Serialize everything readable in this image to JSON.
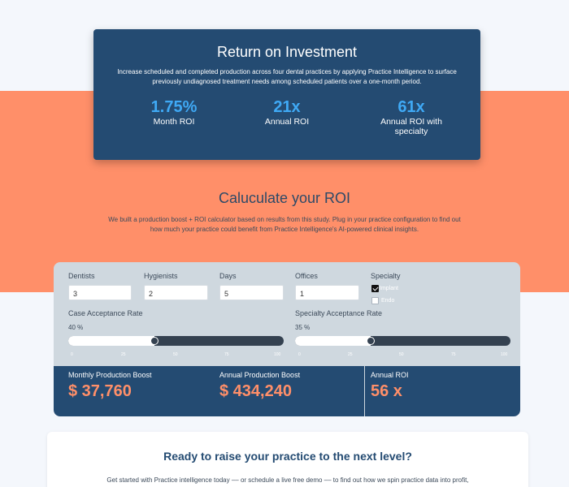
{
  "roi": {
    "title": "Return on Investment",
    "description": "Increase scheduled and completed production across four dental practices by applying Practice Intelligence to surface previously undiagnosed treatment needs among scheduled patients over a one-month period.",
    "stats": [
      {
        "value": "1.75%",
        "label": "Month ROI"
      },
      {
        "value": "21x",
        "label": "Annual ROI"
      },
      {
        "value": "61x",
        "label": "Annual ROI with specialty"
      }
    ]
  },
  "calculator": {
    "title": "Caluculate your ROI",
    "description": "We built a production boost + ROI calculator based on results from this study. Plug in your practice configuration to find out how much your practice could benefit from Practice Intelligence's AI-powered clinical insights.",
    "fields": {
      "dentists": {
        "label": "Dentists",
        "value": "3"
      },
      "hygienists": {
        "label": "Hygienists",
        "value": "2"
      },
      "days": {
        "label": "Days",
        "value": "5"
      },
      "offices": {
        "label": "Offices",
        "value": "1"
      }
    },
    "specialty": {
      "label": "Specialty",
      "options": [
        {
          "label": "Implant",
          "checked": true
        },
        {
          "label": "Endo",
          "checked": false
        }
      ]
    },
    "case_acceptance": {
      "label": "Case Acceptance Rate",
      "value_text": "40 %",
      "value": 40
    },
    "specialty_acceptance": {
      "label": "Specialty Acceptance Rate",
      "value_text": "35 %",
      "value": 35
    },
    "ticks": [
      "0",
      "25",
      "50",
      "75",
      "100"
    ],
    "results": {
      "monthly": {
        "label": "Monthly Production Boost",
        "value": "$ 37,760"
      },
      "annual": {
        "label": "Annual Production Boost",
        "value": "$ 434,240"
      },
      "roi": {
        "label": "Annual ROI",
        "value": "56 x"
      }
    }
  },
  "cta": {
    "title": "Ready to raise your practice to the next level?",
    "text": "Get started with Practice intelligence today –– or schedule a live free demo –– to find out how we spin practice data into profit,"
  },
  "colors": {
    "navy": "#244b72",
    "coral": "#ff8f69",
    "accent_blue": "#3fa9f5"
  }
}
